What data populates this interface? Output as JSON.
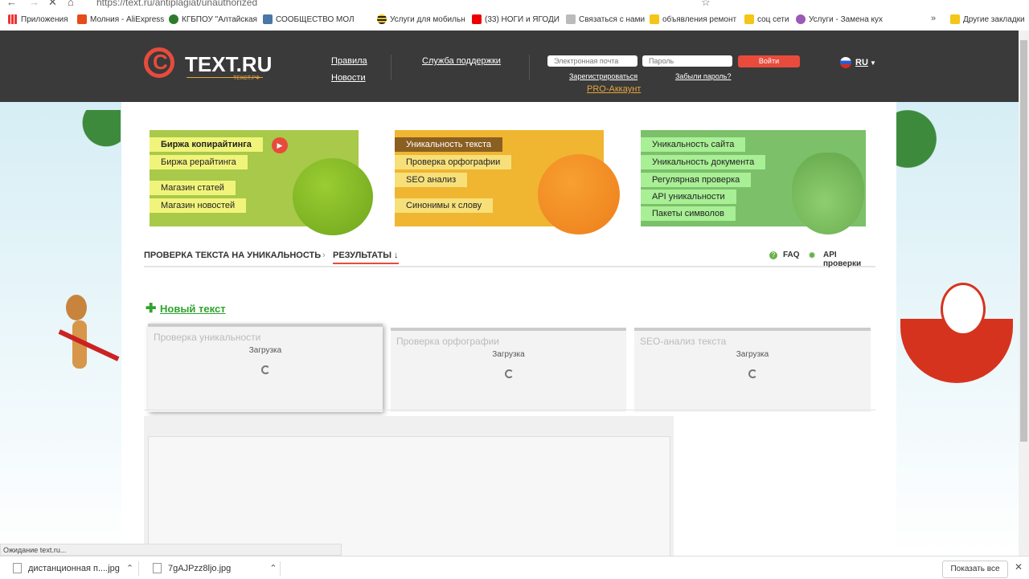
{
  "browser": {
    "url": "https://text.ru/antiplagiat/unauthorized",
    "bookmarks": [
      {
        "label": "Приложения",
        "color": "#e04"
      },
      {
        "label": "Молния - AliExpress",
        "color": "#e44c1a"
      },
      {
        "label": "КГБПОУ \"Алтайская",
        "color": "#2d7a2d"
      },
      {
        "label": "СООБЩЕСТВО МОЛ",
        "color": "#4a76a8"
      },
      {
        "label": "Услуги для мобильн",
        "color": "#333"
      },
      {
        "label": "(33) НОГИ и ЯГОДИ",
        "color": "#e00"
      },
      {
        "label": "Связаться с нами",
        "color": "#888"
      },
      {
        "label": "объявления ремонт",
        "color": "#f5c518"
      },
      {
        "label": "соц сети",
        "color": "#f5c518"
      },
      {
        "label": "Услуги - Замена кух",
        "color": "#9b59b6"
      },
      {
        "label": "Другие закладки",
        "color": "#f5c518"
      }
    ],
    "status_text": "Ожидание text.ru...",
    "downloads": [
      {
        "name": "дистанционная п....jpg"
      },
      {
        "name": "7gAJPzz8ljo.jpg"
      }
    ],
    "show_all": "Показать все"
  },
  "header": {
    "logo_text": "TEXT.RU",
    "logo_sub": "ТЕКСТ.РФ",
    "nav": {
      "rules": "Правила",
      "news": "Новости",
      "support": "Служба поддержки"
    },
    "email_placeholder": "Электронная почта",
    "password_placeholder": "Пароль",
    "login_button": "Войти",
    "register": "Зарегистрироваться",
    "forgot": "Забыли пароль?",
    "pro": "PRO-Аккаунт",
    "lang": "RU"
  },
  "banners": {
    "green": [
      "Биржа копирайтинга",
      "Биржа рерайтинга",
      "Магазин статей",
      "Магазин новостей"
    ],
    "orange": [
      "Уникальность текста",
      "Проверка орфографии",
      "SEO анализ",
      "Синонимы к слову"
    ],
    "pear": [
      "Уникальность сайта",
      "Уникальность документа",
      "Регулярная проверка",
      "API уникальности",
      "Пакеты символов"
    ]
  },
  "crumbs": {
    "first": "ПРОВЕРКА ТЕКСТА НА УНИКАЛЬНОСТЬ",
    "second": "РЕЗУЛЬТАТЫ ↓",
    "faq": "FAQ",
    "api": "API проверки"
  },
  "new_text": "Новый текст",
  "results": [
    {
      "title": "Проверка уникальности",
      "status": "Загрузка"
    },
    {
      "title": "Проверка орфографии",
      "status": "Загрузка"
    },
    {
      "title": "SEO-анализ текста",
      "status": "Загрузка"
    }
  ]
}
